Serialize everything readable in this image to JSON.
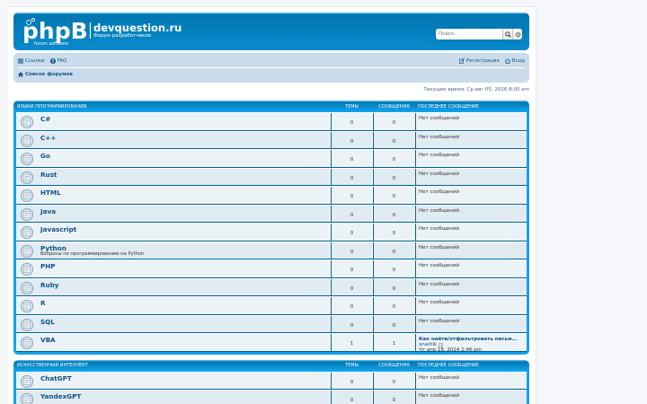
{
  "header": {
    "site_title": "devquestion.ru",
    "site_description": "Форум разработчиков",
    "logo_text": "phpBB",
    "logo_subtext": "forum software",
    "search_placeholder": "Поиск…",
    "search_icon": "search-icon",
    "advanced_search_icon": "gear-icon"
  },
  "navbar": {
    "links_label": "Ссылки",
    "faq_label": "FAQ",
    "register_label": "Регистрация",
    "login_label": "Вход",
    "breadcrumb_label": "Список форумов"
  },
  "current_time": "Текущее время: Ср авг 05, 2026 8:00 am",
  "columns": {
    "topics": "Темы",
    "posts": "Сообщения",
    "last_post": "Последнее сообщение"
  },
  "categories": [
    {
      "name": "Языки программирования",
      "forums": [
        {
          "name": "C#",
          "desc": "",
          "topics": "0",
          "posts": "0",
          "last": "Нет сообщений"
        },
        {
          "name": "C++",
          "desc": "",
          "topics": "0",
          "posts": "0",
          "last": "Нет сообщений"
        },
        {
          "name": "Go",
          "desc": "",
          "topics": "0",
          "posts": "0",
          "last": "Нет сообщений"
        },
        {
          "name": "Rust",
          "desc": "",
          "topics": "0",
          "posts": "0",
          "last": "Нет сообщений"
        },
        {
          "name": "HTML",
          "desc": "",
          "topics": "0",
          "posts": "0",
          "last": "Нет сообщений"
        },
        {
          "name": "Java",
          "desc": "",
          "topics": "0",
          "posts": "0",
          "last": "Нет сообщений"
        },
        {
          "name": "Javascript",
          "desc": "",
          "topics": "0",
          "posts": "0",
          "last": "Нет сообщений"
        },
        {
          "name": "Python",
          "desc": "Вопросы по программированию на Python",
          "topics": "0",
          "posts": "0",
          "last": "Нет сообщений"
        },
        {
          "name": "PHP",
          "desc": "",
          "topics": "0",
          "posts": "0",
          "last": "Нет сообщений"
        },
        {
          "name": "Ruby",
          "desc": "",
          "topics": "0",
          "posts": "0",
          "last": "Нет сообщений"
        },
        {
          "name": "R",
          "desc": "",
          "topics": "0",
          "posts": "0",
          "last": "Нет сообщений"
        },
        {
          "name": "SQL",
          "desc": "",
          "topics": "0",
          "posts": "0",
          "last": "Нет сообщений"
        },
        {
          "name": "VBA",
          "desc": "",
          "topics": "1",
          "posts": "1",
          "last": "",
          "last_title": "Как найти/отфильтровать письм…",
          "last_author": "anaitlik",
          "last_date": "Чт апр 18, 2024 2:46 pm"
        }
      ]
    },
    {
      "name": "Искусственный интеллект",
      "forums": [
        {
          "name": "ChatGPT",
          "desc": "",
          "topics": "0",
          "posts": "0",
          "last": "Нет сообщений"
        },
        {
          "name": "YandexGPT",
          "desc": "",
          "topics": "0",
          "posts": "0",
          "last": "Нет сообщений"
        }
      ]
    }
  ],
  "colors": {
    "header_blue": "#12a3eb",
    "link_blue": "#105289",
    "navbar_bg": "#cadceb"
  }
}
